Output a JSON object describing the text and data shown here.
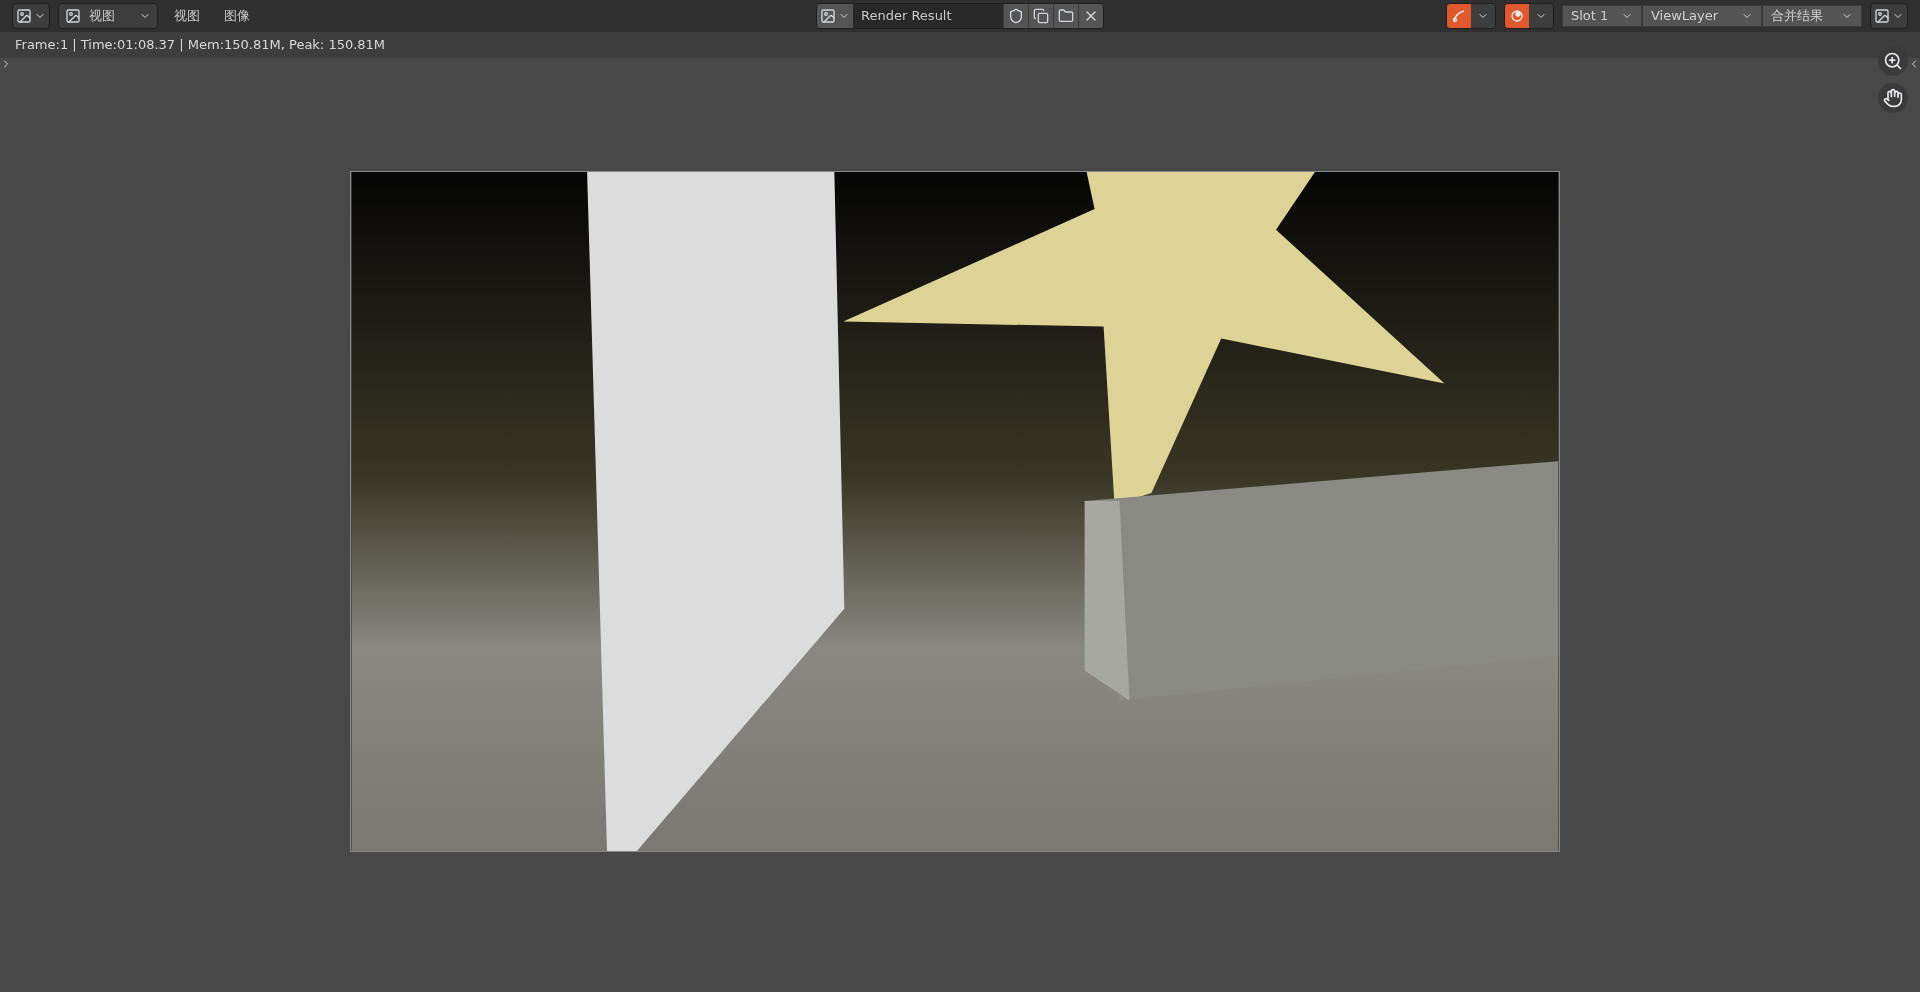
{
  "header": {
    "view_mode": {
      "label": "视图"
    },
    "menus": [
      "视图",
      "图像"
    ],
    "image": {
      "name": "Render Result"
    },
    "toggles": [
      {
        "on": true
      },
      {
        "on": true
      }
    ],
    "slot": "Slot 1",
    "view_layer": "ViewLayer",
    "pass": "合并结果"
  },
  "status": "Frame:1 | Time:01:08.37 | Mem:150.81M, Peak: 150.81M"
}
